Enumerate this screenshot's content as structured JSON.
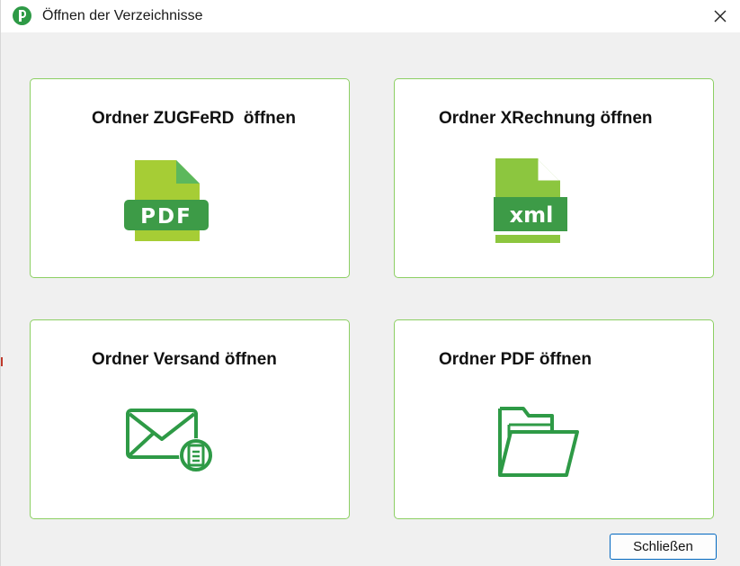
{
  "window": {
    "title": "Öffnen der Verzeichnisse",
    "app_icon": "app-logo-icon",
    "close_icon": "close-icon"
  },
  "cards": [
    {
      "label": "Ordner ZUGFeRD  öffnen",
      "icon": "pdf-file-icon",
      "icon_text": "PDF"
    },
    {
      "label": "Ordner XRechnung öffnen",
      "icon": "xml-file-icon",
      "icon_text": "xml"
    },
    {
      "label": "Ordner Versand öffnen",
      "icon": "mail-document-icon"
    },
    {
      "label": "Ordner PDF öffnen",
      "icon": "open-folder-icon"
    }
  ],
  "footer": {
    "close_label": "Schließen"
  },
  "colors": {
    "accent_green": "#8cc63f",
    "dark_green": "#2e9a46",
    "card_border": "#8ccf63",
    "button_border": "#0067c0"
  }
}
